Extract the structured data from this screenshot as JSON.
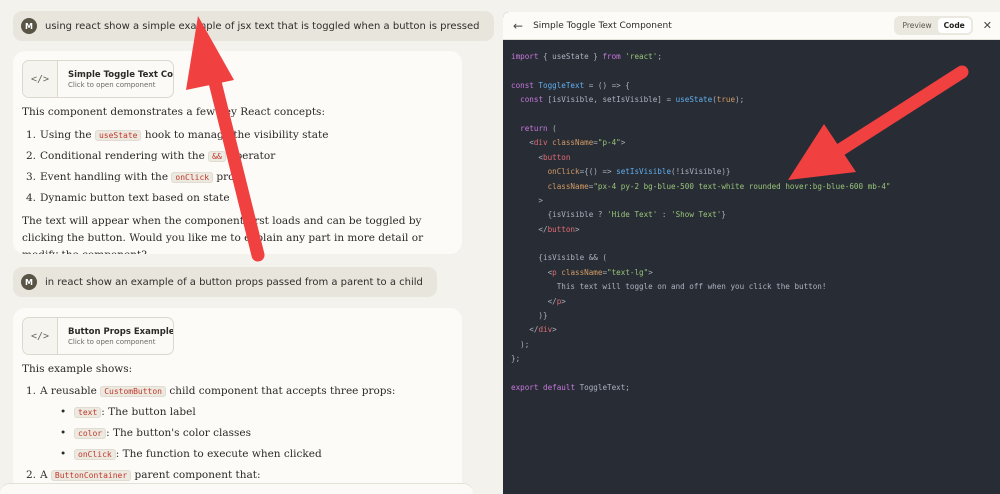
{
  "chat": {
    "user_messages": [
      {
        "avatar": "M",
        "text": "using react show a simple example of jsx text that is toggled when a button is pressed"
      },
      {
        "avatar": "M",
        "text": "in react show an example of a button props passed from a parent to a child"
      }
    ],
    "reply1": {
      "artifact": {
        "icon": "</>",
        "title": "Simple Toggle Text Component",
        "subtitle": "Click to open component"
      },
      "intro": "This component demonstrates a few key React concepts:",
      "items": [
        {
          "num": "1.",
          "pre": "Using the ",
          "code": "useState",
          "post": " hook to manage the visibility state"
        },
        {
          "num": "2.",
          "pre": "Conditional rendering with the ",
          "code": "&&",
          "post": " operator"
        },
        {
          "num": "3.",
          "pre": "Event handling with the ",
          "code": "onClick",
          "post": " prop"
        },
        {
          "num": "4.",
          "pre": "Dynamic button text based on state",
          "code": "",
          "post": ""
        }
      ],
      "outro": "The text will appear when the component first loads and can be toggled by clicking the button. Would you like me to explain any part in more detail or modify the component?"
    },
    "reply2": {
      "artifact": {
        "icon": "</>",
        "title": "Button Props Example",
        "subtitle": "Click to open component"
      },
      "intro": "This example shows:",
      "item1": {
        "num": "1.",
        "pre": "A reusable ",
        "code": "CustomButton",
        "post": " child component that accepts three props:"
      },
      "subitems": [
        {
          "code": "text",
          "post": ": The button label"
        },
        {
          "code": "color",
          "post": ": The button's color classes"
        },
        {
          "code": "onClick",
          "post": ": The function to execute when clicked"
        }
      ],
      "item2": {
        "num": "2.",
        "pre": "A ",
        "code": "ButtonContainer",
        "post": " parent component that:"
      }
    }
  },
  "panel": {
    "back_icon": "←",
    "title": "Simple Toggle Text Component",
    "tabs": {
      "preview": "Preview",
      "code": "Code",
      "active": "Code"
    },
    "close_icon": "✕",
    "code_lines": [
      [
        [
          "kw",
          "import"
        ],
        [
          "pl",
          " { useState } "
        ],
        [
          "kw",
          "from"
        ],
        [
          "str",
          " 'react'"
        ],
        [
          "pl",
          ";"
        ]
      ],
      [],
      [
        [
          "kw",
          "const"
        ],
        [
          "fn",
          " ToggleText"
        ],
        [
          "pl",
          " = () => {"
        ]
      ],
      [
        [
          "pl",
          "  "
        ],
        [
          "kw",
          "const"
        ],
        [
          "pl",
          " [isVisible, setIsVisible] = "
        ],
        [
          "fn",
          "useState"
        ],
        [
          "pl",
          "("
        ],
        [
          "attr",
          "true"
        ],
        [
          "pl",
          ");"
        ]
      ],
      [],
      [
        [
          "pl",
          "  "
        ],
        [
          "kw",
          "return"
        ],
        [
          "pl",
          " ("
        ]
      ],
      [
        [
          "pl",
          "    <"
        ],
        [
          "tag",
          "div"
        ],
        [
          "attr",
          " className"
        ],
        [
          "pl",
          "="
        ],
        [
          "str",
          "\"p-4\""
        ],
        [
          "pl",
          ">"
        ]
      ],
      [
        [
          "pl",
          "      <"
        ],
        [
          "tag",
          "button"
        ]
      ],
      [
        [
          "attr",
          "        onClick"
        ],
        [
          "pl",
          "={() => "
        ],
        [
          "fn",
          "setIsVisible"
        ],
        [
          "pl",
          "(!isVisible)}"
        ]
      ],
      [
        [
          "attr",
          "        className"
        ],
        [
          "pl",
          "="
        ],
        [
          "str",
          "\"px-4 py-2 bg-blue-500 text-white rounded hover:bg-blue-600 mb-4\""
        ]
      ],
      [
        [
          "pl",
          "      >"
        ]
      ],
      [
        [
          "pl",
          "        {isVisible ? "
        ],
        [
          "str",
          "'Hide Text'"
        ],
        [
          "pl",
          " : "
        ],
        [
          "str",
          "'Show Text'"
        ],
        [
          "pl",
          "}"
        ]
      ],
      [
        [
          "pl",
          "      </"
        ],
        [
          "tag",
          "button"
        ],
        [
          "pl",
          ">"
        ]
      ],
      [],
      [
        [
          "pl",
          "      {isVisible && ("
        ]
      ],
      [
        [
          "pl",
          "        <"
        ],
        [
          "tag",
          "p"
        ],
        [
          "attr",
          " className"
        ],
        [
          "pl",
          "="
        ],
        [
          "str",
          "\"text-lg\""
        ],
        [
          "pl",
          ">"
        ]
      ],
      [
        [
          "pl",
          "          This text will toggle on and off when you click the button!"
        ]
      ],
      [
        [
          "pl",
          "        </"
        ],
        [
          "tag",
          "p"
        ],
        [
          "pl",
          ">"
        ]
      ],
      [
        [
          "pl",
          "      )}"
        ]
      ],
      [
        [
          "pl",
          "    </"
        ],
        [
          "tag",
          "div"
        ],
        [
          "pl",
          ">"
        ]
      ],
      [
        [
          "pl",
          "  );"
        ]
      ],
      [
        [
          "pl",
          "};"
        ]
      ],
      [],
      [
        [
          "kw",
          "export"
        ],
        [
          "kw",
          " default"
        ],
        [
          "pl",
          " ToggleText;"
        ]
      ]
    ]
  },
  "colors": {
    "arrow": "#f04040",
    "code_bg": "#282c34",
    "chat_bg": "#f4f2ec"
  }
}
